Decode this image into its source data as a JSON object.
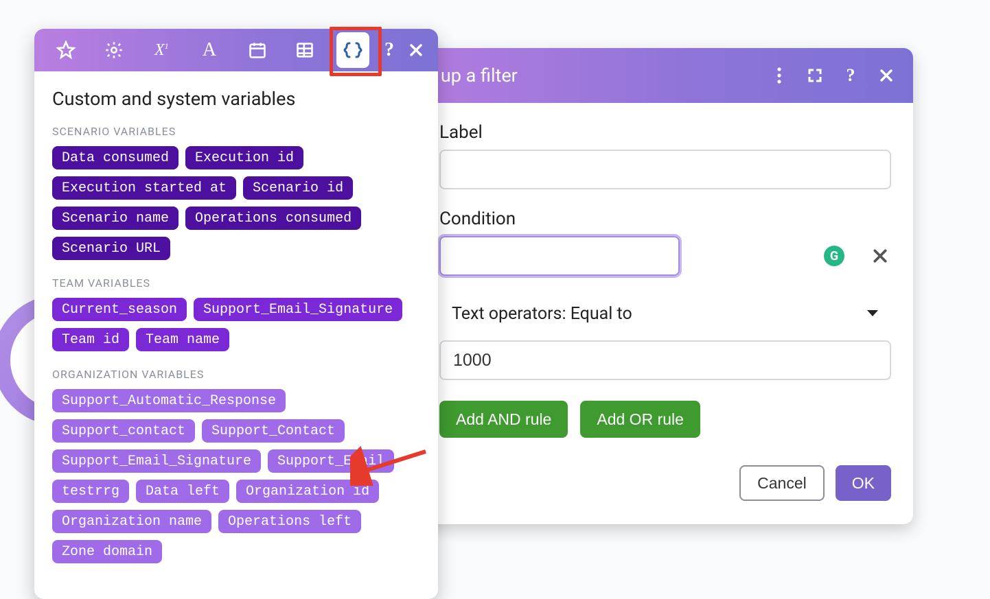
{
  "bgModule": {
    "iconName": "tools-icon"
  },
  "filterDialog": {
    "title": "Set up a filter",
    "labelLabel": "Label",
    "labelValue": "",
    "conditionLabel": "Condition",
    "conditionValue": "",
    "operatorText": "Text operators: Equal to",
    "valueInput": "1000",
    "addAnd": "Add AND rule",
    "addOr": "Add OR rule",
    "cancel": "Cancel",
    "ok": "OK",
    "grammarlyBadge": "G"
  },
  "varPopover": {
    "title": "Custom and system variables",
    "tabs": [
      {
        "name": "star-icon"
      },
      {
        "name": "gear-icon"
      },
      {
        "name": "math-x1-icon"
      },
      {
        "name": "text-a-icon"
      },
      {
        "name": "calendar-icon"
      },
      {
        "name": "array-table-icon"
      },
      {
        "name": "braces-icon",
        "active": true
      }
    ],
    "groups": [
      {
        "label": "SCENARIO VARIABLES",
        "tone": "dark",
        "pills": [
          "Data consumed",
          "Execution id",
          "Execution started at",
          "Scenario id",
          "Scenario name",
          "Operations consumed",
          "Scenario URL"
        ]
      },
      {
        "label": "TEAM VARIABLES",
        "tone": "med",
        "pills": [
          "Current_season",
          "Support_Email_Signature",
          "Team id",
          "Team name"
        ]
      },
      {
        "label": "ORGANIZATION VARIABLES",
        "tone": "light",
        "pills": [
          "Support_Automatic_Response",
          "Support_contact",
          "Support_Contact",
          "Support_Email_Signature",
          "Support_Email",
          "testrrg",
          "Data left",
          "Organization id",
          "Organization name",
          "Operations left",
          "Zone domain"
        ]
      }
    ]
  }
}
